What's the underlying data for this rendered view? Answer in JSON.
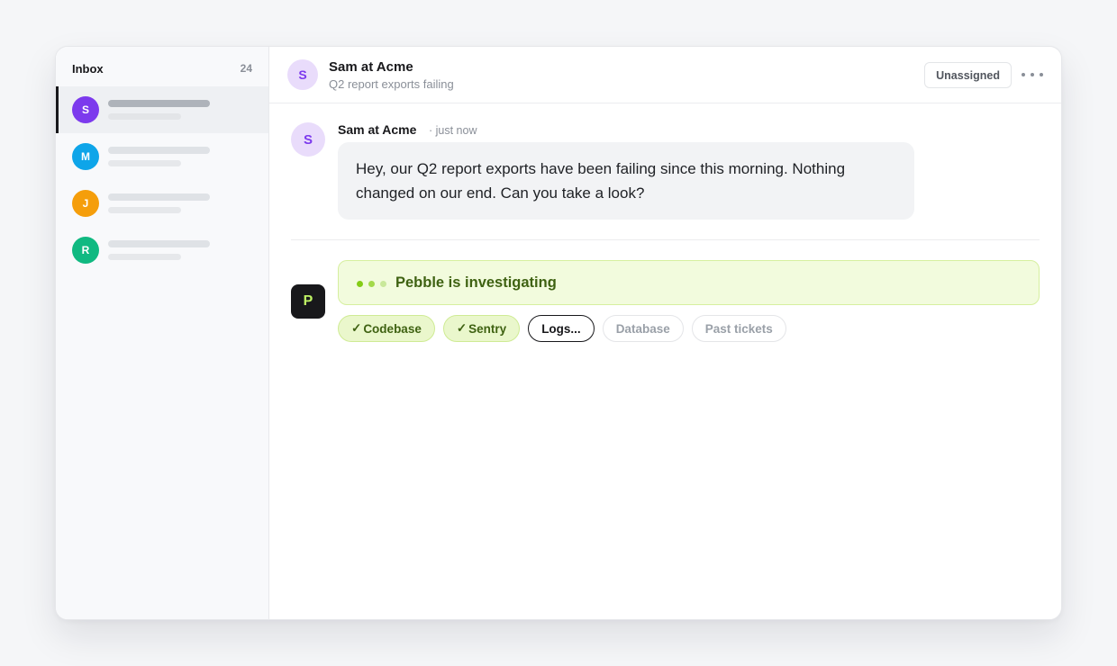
{
  "sidebar": {
    "title": "Inbox",
    "count": "24",
    "conversations": [
      {
        "initial": "S",
        "color": "#7c3aed",
        "active": true
      },
      {
        "initial": "M",
        "color": "#0ea5e9",
        "active": false
      },
      {
        "initial": "J",
        "color": "#f59e0b",
        "active": false
      },
      {
        "initial": "R",
        "color": "#10b981",
        "active": false
      }
    ]
  },
  "header": {
    "avatar_initial": "S",
    "name": "Sam at Acme",
    "subject": "Q2 report exports failing",
    "assign_label": "Unassigned",
    "more_icon": "more-horizontal-icon"
  },
  "message": {
    "avatar_initial": "S",
    "author": "Sam at Acme",
    "time": "· just now",
    "body": "Hey, our Q2 report exports have been failing since this morning. Nothing changed on our end. Can you take a look?"
  },
  "agent": {
    "avatar_initial": "P",
    "status": "Pebble is investigating",
    "sources": [
      {
        "label": "Codebase",
        "state": "done",
        "check": "✓"
      },
      {
        "label": "Sentry",
        "state": "done",
        "check": "✓"
      },
      {
        "label": "Logs...",
        "state": "active",
        "check": ""
      },
      {
        "label": "Database",
        "state": "pending",
        "check": ""
      },
      {
        "label": "Past tickets",
        "state": "pending",
        "check": ""
      }
    ]
  },
  "colors": {
    "accent_green": "#84cc16",
    "avatar_purple": "#7c3aed",
    "agent_dark": "#18181b"
  }
}
